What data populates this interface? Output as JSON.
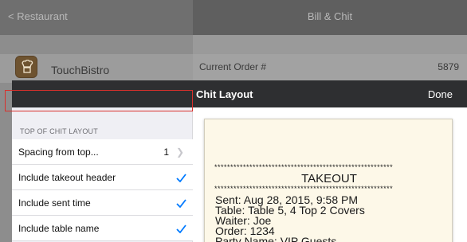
{
  "background": {
    "back_label": "< Restaurant",
    "title": "Bill & Chit",
    "brand_name": "TouchBistro",
    "current_order_label": "Current Order #",
    "current_order_number": "5879"
  },
  "modal": {
    "title": "Chit Layout",
    "done_label": "Done"
  },
  "settings": {
    "section_header": "TOP OF CHIT LAYOUT",
    "spacing": {
      "label": "Spacing from top...",
      "value": "1"
    },
    "items": [
      {
        "label": "Include takeout header",
        "checked": true,
        "highlighted": true
      },
      {
        "label": "Include sent time",
        "checked": true
      },
      {
        "label": "Include table name",
        "checked": true
      }
    ]
  },
  "preview": {
    "stars": "********************************************************",
    "header": "TAKEOUT",
    "lines": [
      "Sent: Aug 28, 2015, 9:58 PM",
      "Table: Table 5, 4 Top 2 Covers",
      "Waiter: Joe",
      "Order: 1234",
      "Party Name: VIP Guests"
    ]
  },
  "colors": {
    "accent": "#007aff",
    "highlight_border": "#d9302c",
    "modal_nav": "#2e2f31",
    "paper": "#fdf8e8"
  }
}
